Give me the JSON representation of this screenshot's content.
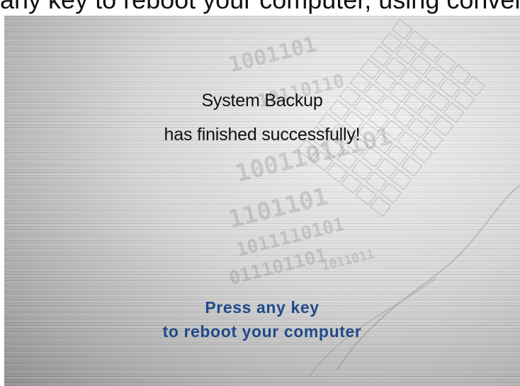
{
  "top_strip": {
    "text": "any key to reboot your computer, using conventional"
  },
  "screen": {
    "status_line_1": "System Backup",
    "status_line_2": "has finished successfully!",
    "prompt_line_1": "Press any key",
    "prompt_line_2": "to reboot your computer",
    "background_art": "keyboard-and-binary-watermark"
  },
  "colors": {
    "status_text": "#111111",
    "prompt_text": "#1f4a8a",
    "brushed_metal_light": "#f0f0f0",
    "brushed_metal_dark": "#8c8c8c"
  }
}
